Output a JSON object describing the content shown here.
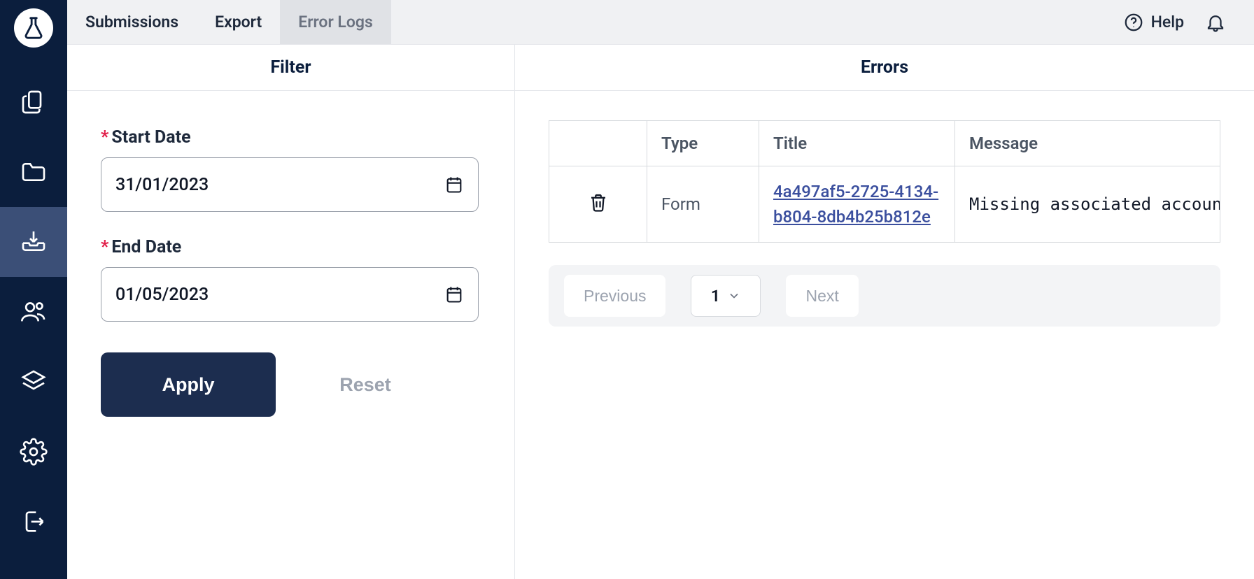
{
  "topbar": {
    "tabs": [
      {
        "label": "Submissions"
      },
      {
        "label": "Export"
      },
      {
        "label": "Error Logs"
      }
    ],
    "active_tab_index": 2,
    "help_label": "Help"
  },
  "filter": {
    "header": "Filter",
    "start_date_label": "Start Date",
    "start_date_value": "31/01/2023",
    "end_date_label": "End Date",
    "end_date_value": "01/05/2023",
    "apply_label": "Apply",
    "reset_label": "Reset"
  },
  "errors": {
    "header": "Errors",
    "columns": {
      "type": "Type",
      "title": "Title",
      "message": "Message"
    },
    "rows": [
      {
        "type": "Form",
        "title": "4a497af5-2725-4134-b804-8db4b25b812e",
        "message": "Missing associated account id"
      }
    ]
  },
  "pagination": {
    "previous_label": "Previous",
    "next_label": "Next",
    "current_page": "1"
  }
}
